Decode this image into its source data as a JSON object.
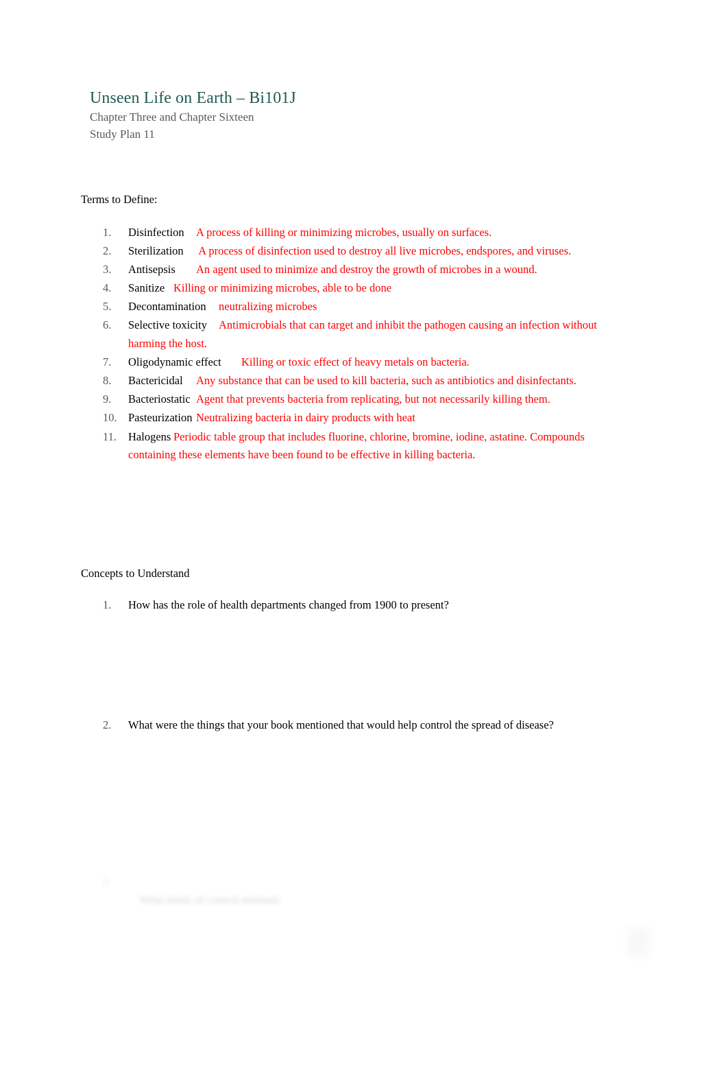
{
  "document": {
    "title": "Unseen Life on Earth – Bi101J",
    "subtitle_line1": "Chapter Three and Chapter Sixteen",
    "subtitle_line2": "Study Plan 11",
    "title_color": "#1F5B52",
    "subtitle_color": "#595959",
    "definition_color": "#FF0000",
    "body_color": "#000000"
  },
  "terms_section": {
    "heading": "Terms to Define:",
    "items": [
      {
        "number": "1.",
        "term": "Disinfection\t",
        "definition": "A process of killing or minimizing microbes, usually on surfaces."
      },
      {
        "number": "2.",
        "term": "Sterilization\t",
        "definition": " A process of disinfection used to destroy all live microbes, endspores, and viruses."
      },
      {
        "number": "3.",
        "term": "Antisepsis\t",
        "definition": "An agent used to minimize and destroy the growth of microbes in a wound."
      },
      {
        "number": "4.",
        "term": "Sanitize\t",
        "definition": "Killing or minimizing microbes, able to be done"
      },
      {
        "number": "5.",
        "term": "Decontamination\t",
        "definition": "neutralizing microbes"
      },
      {
        "number": "6.",
        "term": "Selective toxicity\t",
        "definition": "Antimicrobials that can target and inhibit the pathogen causing an infection without harming the host."
      },
      {
        "number": "7.",
        "term": "Oligodynamic effect\t",
        "definition": "Killing or toxic effect of heavy metals on bacteria."
      },
      {
        "number": "8.",
        "term": "Bactericidal\t",
        "definition": "Any substance that can be used to kill bacteria, such as antibiotics and disinfectants."
      },
      {
        "number": "9.",
        "term": "Bacteriostatic\t",
        "definition": "Agent that prevents bacteria from replicating, but not necessarily killing them."
      },
      {
        "number": "10.",
        "term": "Pasteurization\t",
        "definition": "Neutralizing bacteria in dairy products with heat"
      },
      {
        "number": "11.",
        "term": "Halogens\t",
        "definition": "Periodic table group that includes fluorine, chlorine, bromine, iodine, astatine. Compounds containing these elements have been found to be effective in killing bacteria."
      }
    ]
  },
  "concepts_section": {
    "heading": "Concepts to Understand",
    "items": [
      {
        "number": "1.",
        "question": "How has the role of health departments changed from 1900 to present?"
      },
      {
        "number": "2.",
        "question": "What were the things that your book mentioned that would help control the spread of disease?"
      }
    ]
  },
  "obscured": {
    "number": "3.",
    "text": "What kinds of control methods"
  }
}
